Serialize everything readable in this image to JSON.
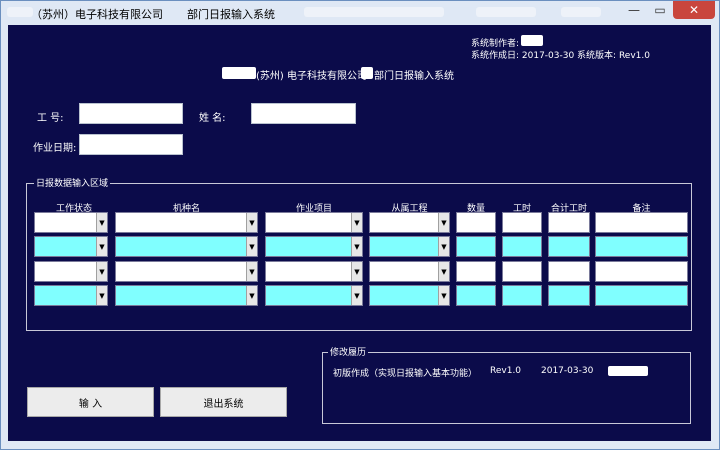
{
  "window": {
    "title_prefix": "（苏州）电子科技有限公司",
    "title_suffix": "部门日报输入系统",
    "minimize": "—",
    "maximize": "▭",
    "close": "✕"
  },
  "info": {
    "author_label": "系统制作者:",
    "created_line": "系统作成日: 2017-03-30    系统版本: Rev1.0"
  },
  "header": {
    "left": "(苏州) 电子科技有限公司",
    "right": "部门日报输入系统"
  },
  "form": {
    "employee_no_label": "工    号:",
    "name_label": "姓    名:",
    "work_date_label": "作业日期:",
    "employee_no_value": "",
    "name_value": "",
    "work_date_value": ""
  },
  "grid": {
    "title": "日报数据输入区域",
    "columns": [
      "工作状态",
      "机种名",
      "作业项目",
      "从属工程",
      "数量",
      "工时",
      "合计工时",
      "备注"
    ],
    "row_count": 4
  },
  "history": {
    "title": "修改履历",
    "entry_desc": "初版作成（实现日报输入基本功能）",
    "entry_version": "Rev1.0",
    "entry_date": "2017-03-30"
  },
  "buttons": {
    "input": "输    入",
    "exit": "退出系统"
  },
  "icons": {
    "dropdown": "chevron-down-icon"
  },
  "colors": {
    "background": "#0b0b4a",
    "cyan_row": "#80ffff",
    "close_button": "#c9463d"
  }
}
